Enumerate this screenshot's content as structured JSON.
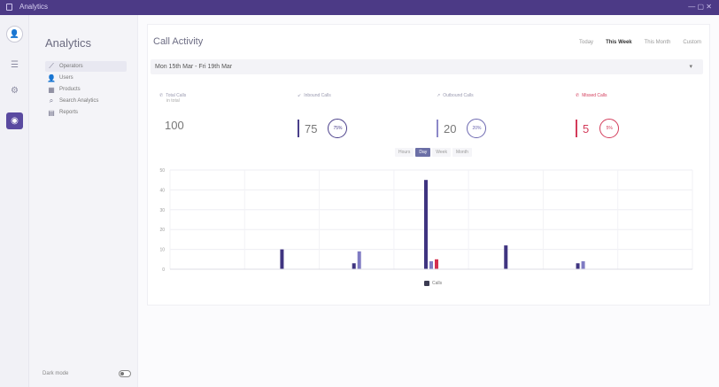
{
  "titlebar": {
    "title": "Analytics",
    "window_controls": "— ▢ ✕"
  },
  "rail": {
    "items": [
      {
        "name": "avatar",
        "icon": "person-icon",
        "glyph": "👤"
      },
      {
        "name": "rail-tasks",
        "icon": "tasks-icon",
        "glyph": "☰"
      },
      {
        "name": "rail-settings",
        "icon": "gear-icon",
        "glyph": "⚙"
      },
      {
        "name": "rail-analytics",
        "icon": "analytics-icon",
        "glyph": "◉",
        "active": true
      }
    ]
  },
  "sidebar": {
    "title": "Analytics",
    "items": [
      {
        "label": "Operators",
        "icon": "line-chart-icon",
        "glyph": "⟋",
        "active": true
      },
      {
        "label": "Users",
        "icon": "user-icon",
        "glyph": "👤"
      },
      {
        "label": "Products",
        "icon": "products-icon",
        "glyph": "▦"
      },
      {
        "label": "Search Analytics",
        "icon": "search-icon",
        "glyph": "⌕"
      },
      {
        "label": "Reports",
        "icon": "report-icon",
        "glyph": "▤"
      }
    ],
    "footer_label": "Dark mode"
  },
  "main": {
    "title": "Call Activity",
    "range_tabs": [
      "Today",
      "This Week",
      "This Month",
      "Custom"
    ],
    "active_range": "This Week",
    "date_range": "Mon 15th Mar - Fri 19th Mar"
  },
  "kpis": [
    {
      "label": "Total Calls",
      "sub": "in total",
      "value": "100",
      "icon": "phone-icon",
      "color": "#9a9ab0",
      "percent": ""
    },
    {
      "label": "Inbound Calls",
      "sub": "",
      "value": "75",
      "icon": "inbound-icon",
      "color": "#4a3f8a",
      "percent": "75%"
    },
    {
      "label": "Outbound Calls",
      "sub": "",
      "value": "20",
      "icon": "outbound-icon",
      "color": "#6b67b0",
      "percent": "20%"
    },
    {
      "label": "Missed Calls",
      "sub": "",
      "value": "5",
      "icon": "missed-call-icon",
      "color": "#d33b5a",
      "percent": "5%"
    }
  ],
  "chart_tabs": [
    "Hours",
    "Day",
    "Week",
    "Month"
  ],
  "active_chart_tab": "Day",
  "chart_data": {
    "type": "bar",
    "categories": [
      "",
      "",
      "",
      "",
      "",
      "",
      ""
    ],
    "series": [
      {
        "color": "#3f3480",
        "values": [
          0,
          10,
          3,
          45,
          12,
          3,
          0
        ]
      },
      {
        "color": "#7f7bc3",
        "values": [
          0,
          0,
          9,
          4,
          0,
          4,
          0
        ]
      },
      {
        "color": "#d4304f",
        "values": [
          0,
          0,
          0,
          5,
          0,
          0,
          0
        ]
      }
    ],
    "ylim": [
      0,
      50
    ],
    "yticks": [
      "0",
      "10",
      "20",
      "30",
      "40",
      "50"
    ],
    "grid": true,
    "legend": "bottom-center",
    "legend_label": "Calls"
  }
}
